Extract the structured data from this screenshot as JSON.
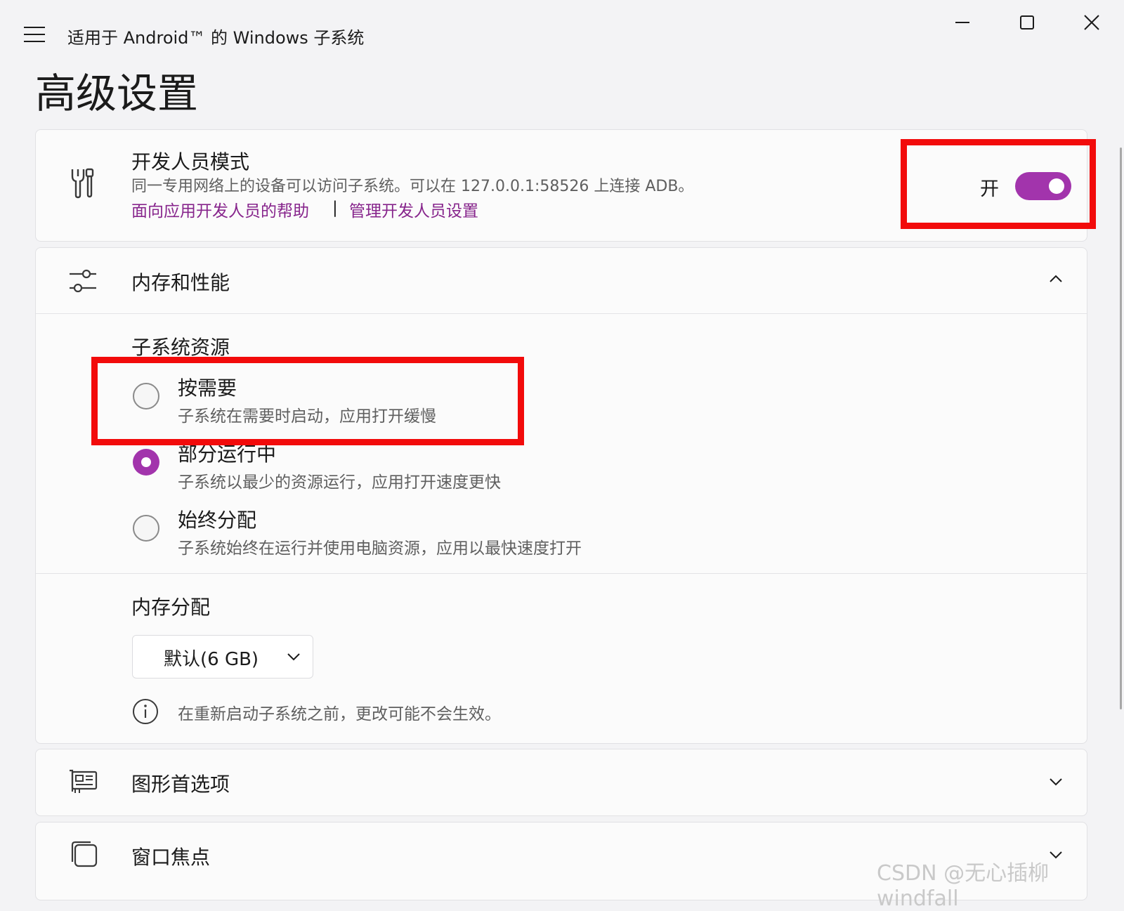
{
  "window": {
    "title": "适用于 Android™ 的 Windows 子系统"
  },
  "page": {
    "title": "高级设置"
  },
  "developer_mode": {
    "title": "开发人员模式",
    "description": "同一专用网络上的设备可以访问子系统。可以在 127.0.0.1:58526 上连接 ADB。",
    "link_help": "面向应用开发人员的帮助",
    "separator": "|",
    "link_manage": "管理开发人员设置",
    "toggle_label": "开",
    "toggle_on": true
  },
  "memory_performance": {
    "title": "内存和性能",
    "resources_heading": "子系统资源",
    "options": [
      {
        "title": "按需要",
        "description": "子系统在需要时启动，应用打开缓慢",
        "selected": false
      },
      {
        "title": "部分运行中",
        "description": "子系统以最少的资源运行，应用打开速度更快",
        "selected": true
      },
      {
        "title": "始终分配",
        "description": "子系统始终在运行并使用电脑资源，应用以最快速度打开",
        "selected": false
      }
    ],
    "memory_heading": "内存分配",
    "memory_value": "默认(6 GB)",
    "info_text": "在重新启动子系统之前，更改可能不会生效。"
  },
  "graphics": {
    "title": "图形首选项"
  },
  "window_focus": {
    "title": "窗口焦点"
  },
  "watermark": "CSDN @无心插柳windfall",
  "colors": {
    "accent": "#a234ac",
    "link": "#87258c",
    "highlight": "#f20b0b",
    "background": "#f3f3f5"
  },
  "icons": {
    "menu": "hamburger-icon",
    "minimize": "minimize-icon",
    "maximize": "maximize-icon",
    "close": "close-icon",
    "developer": "tools-icon",
    "memory": "sliders-icon",
    "graphics": "gpu-card-icon",
    "window_focus": "windows-stack-icon",
    "info": "info-icon"
  }
}
